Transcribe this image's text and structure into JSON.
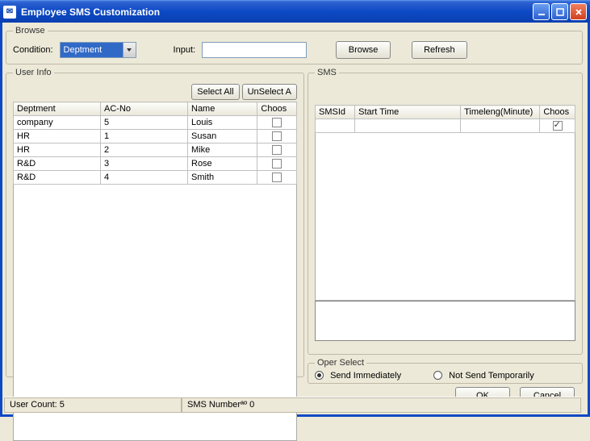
{
  "window": {
    "title": "Employee SMS Customization"
  },
  "browse": {
    "legend": "Browse",
    "condition_label": "Condition:",
    "condition_value": "Deptment",
    "input_label": "Input:",
    "input_value": "",
    "browse_btn": "Browse",
    "refresh_btn": "Refresh"
  },
  "userinfo": {
    "legend": "User Info",
    "select_all": "Select All",
    "unselect_all": "UnSelect A",
    "columns": {
      "c0": "Deptment",
      "c1": "AC-No",
      "c2": "Name",
      "c3": "Choos"
    },
    "rows": [
      {
        "dept": "company",
        "acno": "5",
        "name": "Louis",
        "choose": false
      },
      {
        "dept": "HR",
        "acno": "1",
        "name": "Susan",
        "choose": false
      },
      {
        "dept": "HR",
        "acno": "2",
        "name": "Mike",
        "choose": false
      },
      {
        "dept": "R&D",
        "acno": "3",
        "name": "Rose",
        "choose": false
      },
      {
        "dept": "R&D",
        "acno": "4",
        "name": "Smith",
        "choose": false
      }
    ]
  },
  "sms": {
    "legend": "SMS",
    "columns": {
      "c0": "SMSId",
      "c1": "Start Time",
      "c2": "Timeleng(Minute)",
      "c3": "Choos"
    },
    "rows": [
      {
        "smsid": "",
        "start": "",
        "len": "",
        "choose": true
      }
    ]
  },
  "oper": {
    "legend": "Oper Select",
    "opt_send": "Send Immediately",
    "opt_notsend": "Not Send Temporarily",
    "selected": "send"
  },
  "buttons": {
    "ok": "OK",
    "cancel": "Cancel"
  },
  "status": {
    "user_count_label": "User Count:",
    "user_count_value": "5",
    "sms_number_label": "SMS Numberªº",
    "sms_number_value": "0"
  }
}
